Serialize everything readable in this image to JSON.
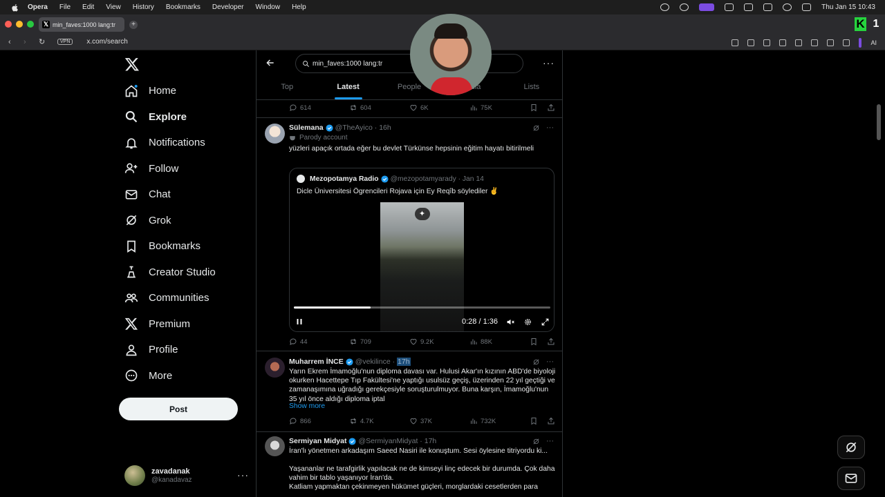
{
  "menubar": {
    "app_name": "Opera",
    "menus": [
      "File",
      "Edit",
      "View",
      "History",
      "Bookmarks",
      "Developer",
      "Window",
      "Help"
    ],
    "clock": "Thu Jan 15  10:43"
  },
  "browser": {
    "tab_title": "min_faves:1000 lang:tr",
    "vpn_label": "VPN",
    "url": "x.com/search",
    "ai_label": "AI"
  },
  "sidebar": {
    "items": [
      {
        "label": "Home",
        "icon": "home-icon"
      },
      {
        "label": "Explore",
        "icon": "search-icon"
      },
      {
        "label": "Notifications",
        "icon": "bell-icon"
      },
      {
        "label": "Follow",
        "icon": "add-user-icon"
      },
      {
        "label": "Chat",
        "icon": "envelope-icon"
      },
      {
        "label": "Grok",
        "icon": "grok-icon"
      },
      {
        "label": "Bookmarks",
        "icon": "bookmark-icon"
      },
      {
        "label": "Creator Studio",
        "icon": "creator-studio-icon"
      },
      {
        "label": "Communities",
        "icon": "communities-icon"
      },
      {
        "label": "Premium",
        "icon": "x-icon"
      },
      {
        "label": "Profile",
        "icon": "person-icon"
      },
      {
        "label": "More",
        "icon": "more-circle-icon"
      }
    ],
    "post_label": "Post",
    "account": {
      "display_name": "zavadanak",
      "handle": "@kanadavaz"
    }
  },
  "search": {
    "query": "min_faves:1000 lang:tr",
    "tabs": [
      "Top",
      "Latest",
      "People",
      "Media",
      "Lists"
    ],
    "active_tab": "Latest"
  },
  "prev_tweet_actions": {
    "replies": "614",
    "reposts": "604",
    "likes": "6K",
    "views": "75K"
  },
  "tweets": [
    {
      "name": "Sülemana",
      "handle": "@TheAyico",
      "time": "16h",
      "badge": "Parody account",
      "text": "yüzleri apaçık ortada eğer bu devlet Türkünse hepsinin eğitim hayatı bitirilmeli",
      "quote": {
        "name": "Mezopotamya Radio",
        "handle": "@mezopotamyarady",
        "time": "Jan 14",
        "text": "Dicle Üniversitesi Ögrencileri Rojava için Ey Reqîb söylediler ✌️",
        "video_time": "0:28 / 1:36",
        "progress": 0.3
      },
      "actions": {
        "replies": "44",
        "reposts": "709",
        "likes": "9.2K",
        "views": "88K"
      }
    },
    {
      "name": "Muharrem İNCE",
      "handle": "@vekilince",
      "time": "17h",
      "text": "Yarın Ekrem İmamoğlu'nun diploma davası var. Hulusi Akar'ın kızının ABD'de biyoloji okurken Hacettepe Tıp Fakültesi'ne yaptığı usulsüz geçiş, üzerinden 22 yıl geçtiği ve zamanaşımına uğradığı gerekçesiyle soruşturulmuyor. Buna karşın, İmamoğlu'nun 35 yıl önce aldığı diploma iptal",
      "show_more": "Show more",
      "actions": {
        "replies": "866",
        "reposts": "4.7K",
        "likes": "37K",
        "views": "732K"
      }
    },
    {
      "name": "Sermiyan Midyat",
      "handle": "@SermiyanMidyat",
      "time": "17h",
      "lines": [
        "İran'lı yönetmen arkadaşım Saeed Nasiri ile konuştum. Sesi öylesine titriyordu ki...",
        "Yaşananlar ne tarafgirlik yapılacak ne de kimseyi linç edecek bir durumda. Çok daha vahim bir tablo yaşanıyor İran'da.",
        "Katliam yapmaktan çekinmeyen hükümet güçleri, morglardaki cesetlerden para"
      ]
    }
  ],
  "colors": {
    "accent": "#1d9bf0",
    "background": "#000000",
    "border": "#2f3336",
    "muted": "#71767b",
    "text": "#e7e9ea"
  }
}
